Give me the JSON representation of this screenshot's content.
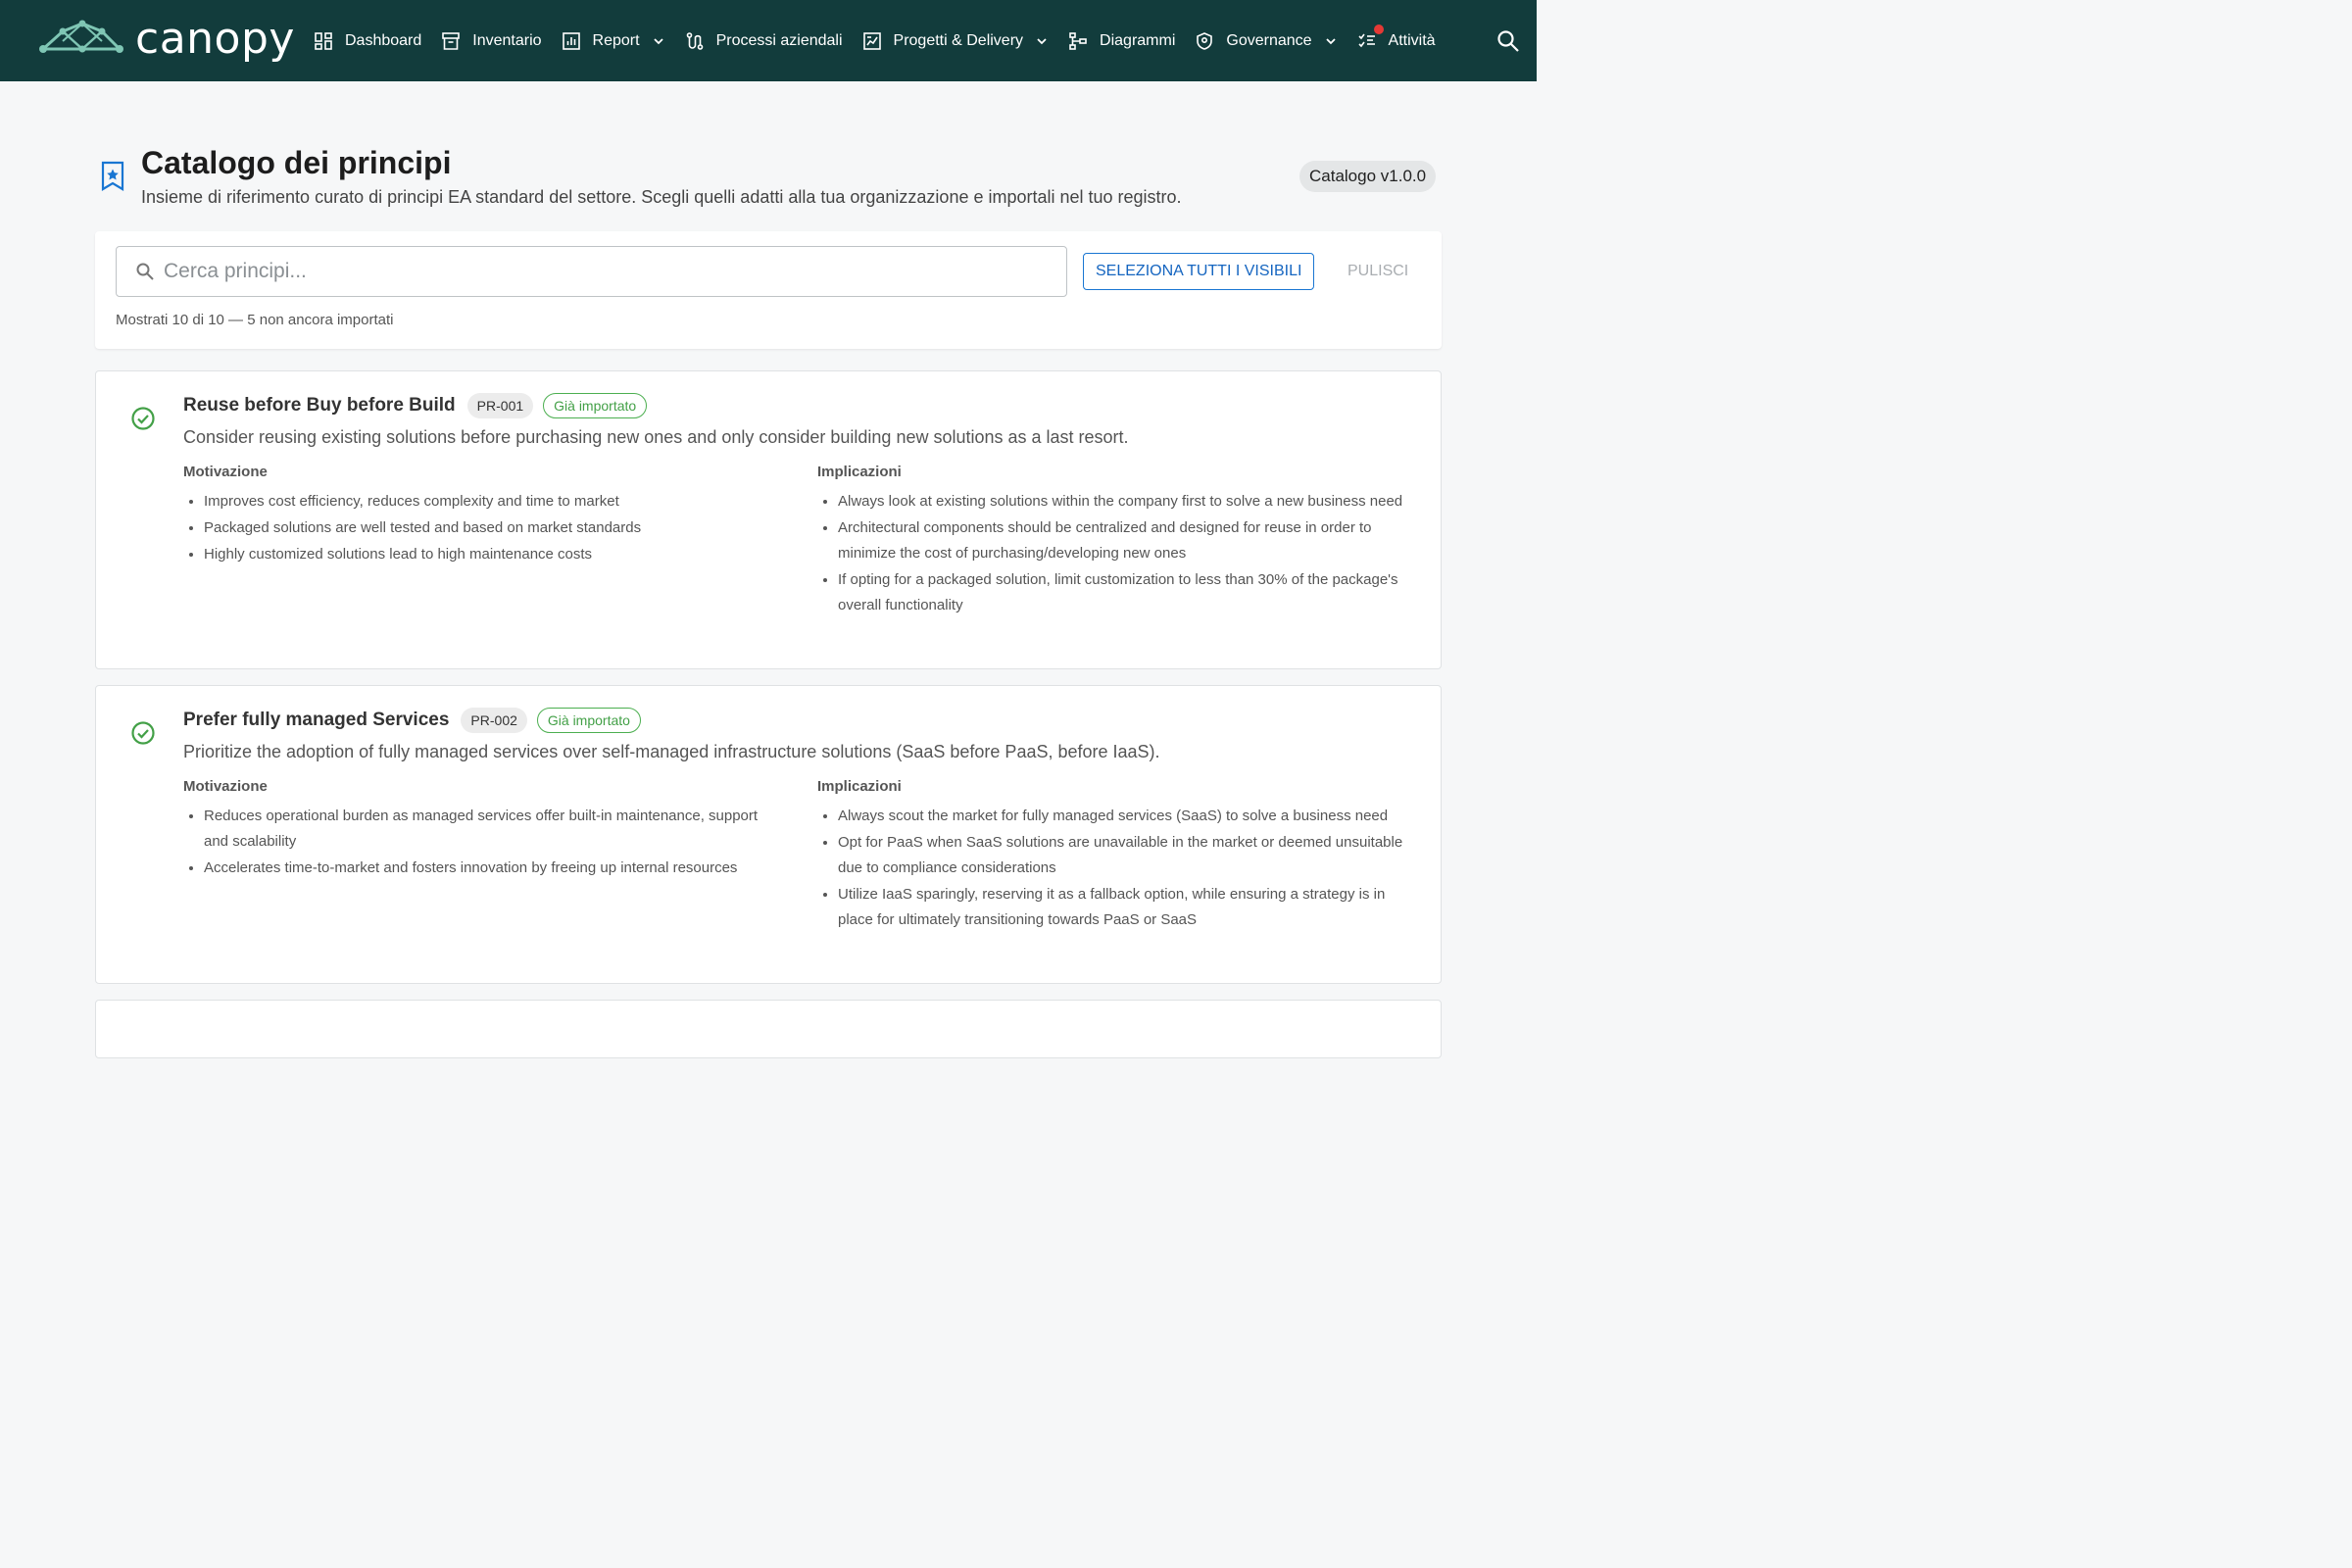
{
  "app": {
    "name": "canopy"
  },
  "nav": {
    "items": [
      {
        "label": "Dashboard",
        "icon": "dashboard-icon"
      },
      {
        "label": "Inventario",
        "icon": "archive-icon"
      },
      {
        "label": "Report",
        "icon": "bar-chart-icon",
        "dropdown": true
      },
      {
        "label": "Processi aziendali",
        "icon": "route-icon"
      },
      {
        "label": "Progetti & Delivery",
        "icon": "project-chart-icon",
        "dropdown": true
      },
      {
        "label": "Diagrammi",
        "icon": "hierarchy-icon"
      },
      {
        "label": "Governance",
        "icon": "shield-icon",
        "dropdown": true
      },
      {
        "label": "Attività",
        "icon": "task-list-icon",
        "notification": true
      }
    ],
    "search_icon": "search-icon"
  },
  "header": {
    "title": "Catalogo dei principi",
    "subtitle": "Insieme di riferimento curato di principi EA standard del settore. Scegli quelli adatti alla tua organizzazione e importali nel tuo registro.",
    "version": "Catalogo v1.0.0"
  },
  "search": {
    "placeholder": "Cerca principi...",
    "value": "",
    "select_all_label": "SELEZIONA TUTTI I VISIBILI",
    "clear_label": "PULISCI",
    "count_text": "Mostrati 10 di 10 — 5 non ancora importati"
  },
  "principles": [
    {
      "title": "Reuse before Buy before Build",
      "id": "PR-001",
      "status": "Già importato",
      "description": "Consider reusing existing solutions before purchasing new ones and only consider building new solutions as a last resort.",
      "motivation_title": "Motivazione",
      "motivation": [
        "Improves cost efficiency, reduces complexity and time to market",
        "Packaged solutions are well tested and based on market standards",
        "Highly customized solutions lead to high maintenance costs"
      ],
      "implications_title": "Implicazioni",
      "implications": [
        "Always look at existing solutions within the company first to solve a new business need",
        "Architectural components should be centralized and designed for reuse in order to minimize the cost of purchasing/developing new ones",
        "If opting for a packaged solution, limit customization to less than 30% of the package's overall functionality"
      ]
    },
    {
      "title": "Prefer fully managed Services",
      "id": "PR-002",
      "status": "Già importato",
      "description": "Prioritize the adoption of fully managed services over self-managed infrastructure solutions (SaaS before PaaS, before IaaS).",
      "motivation_title": "Motivazione",
      "motivation": [
        "Reduces operational burden as managed services offer built-in maintenance, support and scalability",
        "Accelerates time-to-market and fosters innovation by freeing up internal resources"
      ],
      "implications_title": "Implicazioni",
      "implications": [
        "Always scout the market for fully managed services (SaaS) to solve a business need",
        "Opt for PaaS when SaaS solutions are unavailable in the market or deemed unsuitable due to compliance considerations",
        "Utilize IaaS sparingly, reserving it as a fallback option, while ensuring a strategy is in place for ultimately transitioning towards PaaS or SaaS"
      ]
    }
  ],
  "colors": {
    "topbar": "#123c3c",
    "accent": "#1976d2",
    "imported": "#43a047",
    "notification": "#e53935"
  }
}
